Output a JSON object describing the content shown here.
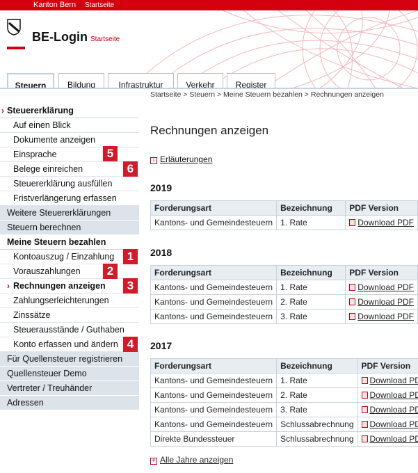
{
  "topbar": {
    "kanton": "Kanton Bern",
    "startseite": "Startseite"
  },
  "header": {
    "title": "BE-Login",
    "startseite": "Startseite"
  },
  "tabs": [
    "Steuern",
    "Bildung",
    "Infrastruktur",
    "Verkehr",
    "Register"
  ],
  "breadcrumb": "Startseite > Steuern > Meine Steuern bezahlen > Rechnungen anzeigen",
  "sidebar": {
    "items": [
      "Steuererklärung",
      "Auf einen Blick",
      "Dokumente anzeigen",
      "Einsprache",
      "Belege einreichen",
      "Steuererklärung ausfüllen",
      "Fristverlängerung erfassen",
      "Weitere Steuererklärungen",
      "Steuern berechnen",
      "Meine Steuern bezahlen",
      "Kontoauszug / Einzahlung",
      "Vorauszahlungen",
      "Rechnungen anzeigen",
      "Zahlungserleichterungen",
      "Zinssätze",
      "Steuerausstände / Guthaben",
      "Konto erfassen und ändern",
      "Für Quellensteuer registrieren",
      "Quellensteuer Demo",
      "Vertreter / Treuhänder",
      "Adressen"
    ],
    "arrow": "›"
  },
  "badges": [
    "5",
    "6",
    "1",
    "2",
    "3",
    "4"
  ],
  "main": {
    "title": "Rechnungen anzeigen",
    "erlaeuterungen": "Erläuterungen",
    "info_icon": "i",
    "columns": [
      "Forderungsart",
      "Bezeichnung",
      "PDF Version"
    ],
    "sections": [
      {
        "year": "2019",
        "rows": [
          [
            "Kantons- und Gemeindesteuern",
            "1. Rate",
            "Download PDF"
          ]
        ]
      },
      {
        "year": "2018",
        "rows": [
          [
            "Kantons- und Gemeindesteuern",
            "1. Rate",
            "Download PDF"
          ],
          [
            "Kantons- und Gemeindesteuern",
            "2. Rate",
            "Download PDF"
          ],
          [
            "Kantons- und Gemeindesteuern",
            "3. Rate",
            "Download PDF"
          ]
        ]
      },
      {
        "year": "2017",
        "rows": [
          [
            "Kantons- und Gemeindesteuern",
            "1. Rate",
            "Download PDF"
          ],
          [
            "Kantons- und Gemeindesteuern",
            "2. Rate",
            "Download PDF"
          ],
          [
            "Kantons- und Gemeindesteuern",
            "3. Rate",
            "Download PDF"
          ],
          [
            "Kantons- und Gemeindesteuern",
            "Schlussabrechnung",
            "Download PDF"
          ],
          [
            "Direkte Bundessteuer",
            "Schlussabrechnung",
            "Download PDF"
          ]
        ]
      }
    ],
    "alle_jahre": "Alle Jahre anzeigen",
    "plus_icon": "+"
  },
  "colors": {
    "brand_red": "#d4000f",
    "sidebar_bg": "#e6ebf0",
    "table_header_bg": "#e8edf2"
  }
}
